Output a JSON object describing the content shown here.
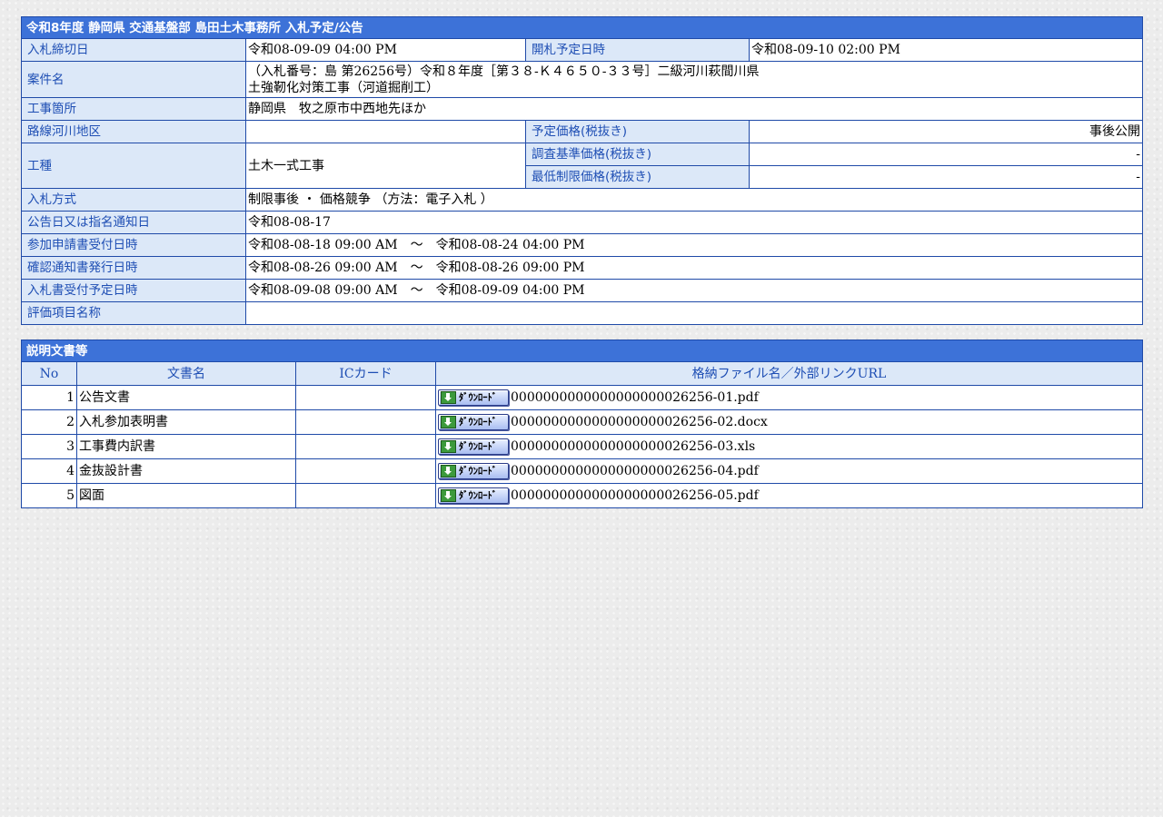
{
  "header": {
    "title": "令和8年度 静岡県 交通基盤部 島田土木事務所 入札予定/公告"
  },
  "details": {
    "deadline_label": "入札締切日",
    "deadline_value": "令和08-09-09 04:00 PM",
    "opening_label": "開札予定日時",
    "opening_value": "令和08-09-10 02:00 PM",
    "project_label": "案件名",
    "project_line1": "（入札番号：島 第26256号）令和８年度［第３８-Ｋ４６５０-３３号］二級河川萩間川県",
    "project_line2": "土強靭化対策工事（河道掘削工）",
    "site_label": "工事箇所",
    "site_value": "静岡県　牧之原市中西地先ほか",
    "route_label": "路線河川地区",
    "route_value": "",
    "est_price_label": "予定価格(税抜き)",
    "est_price_value": "事後公開",
    "work_type_label": "工種",
    "work_type_value": "土木一式工事",
    "survey_price_label": "調査基準価格(税抜き)",
    "survey_price_value": "-",
    "min_price_label": "最低制限価格(税抜き)",
    "min_price_value": "-",
    "method_label": "入札方式",
    "method_value": "制限事後 ・ 価格競争 （方法：電子入札 ）",
    "notice_label": "公告日又は指名通知日",
    "notice_value": "令和08-08-17",
    "apply_label": "参加申請書受付日時",
    "apply_value": "令和08-08-18 09:00 AM　～　令和08-08-24 04:00 PM",
    "confirm_label": "確認通知書発行日時",
    "confirm_value": "令和08-08-26 09:00 AM　～　令和08-08-26 09:00 PM",
    "bid_receipt_label": "入札書受付予定日時",
    "bid_receipt_value": "令和08-09-08 09:00 AM　～　令和08-09-09 04:00 PM",
    "eval_label": "評価項目名称",
    "eval_value": ""
  },
  "documents": {
    "title": "説明文書等",
    "columns": {
      "no": "No",
      "name": "文書名",
      "ic": "ICカード",
      "file": "格納ファイル名／外部リンクURL"
    },
    "download_label": "ﾀﾞｳﾝﾛｰﾄﾞ",
    "rows": [
      {
        "no": "1",
        "name": "公告文書",
        "ic": "",
        "file": "0000000000000000000026256-01.pdf"
      },
      {
        "no": "2",
        "name": "入札参加表明書",
        "ic": "",
        "file": "0000000000000000000026256-02.docx"
      },
      {
        "no": "3",
        "name": "工事費内訳書",
        "ic": "",
        "file": "0000000000000000000026256-03.xls"
      },
      {
        "no": "4",
        "name": "金抜設計書",
        "ic": "",
        "file": "0000000000000000000026256-04.pdf"
      },
      {
        "no": "5",
        "name": "図面",
        "ic": "",
        "file": "0000000000000000000026256-05.pdf"
      }
    ]
  },
  "colors": {
    "header_bg": "#3d72d8",
    "label_bg": "#dce8f8",
    "label_text": "#1e4eb4",
    "border": "#1f4aa8"
  }
}
